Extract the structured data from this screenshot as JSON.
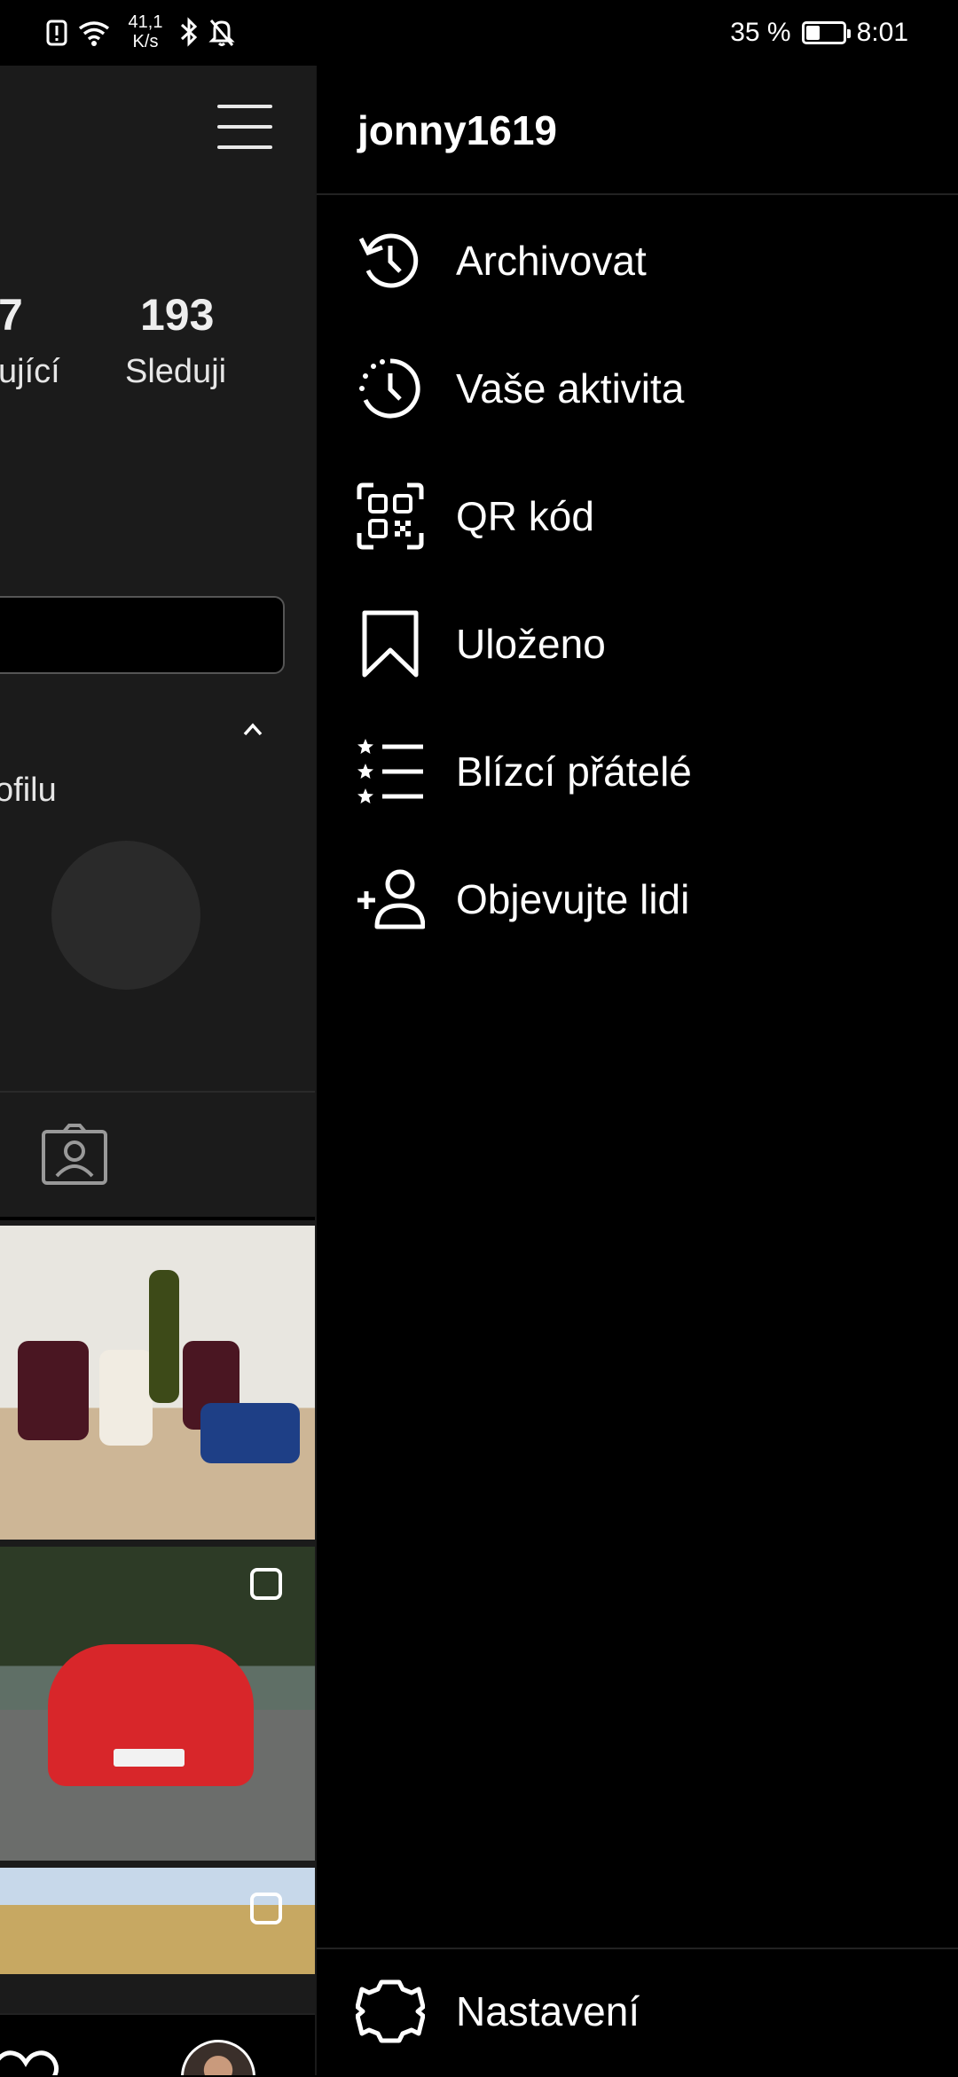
{
  "status_bar": {
    "net_speed_value": "41,1",
    "net_speed_unit": "K/s",
    "battery_percent": "35 %",
    "battery_level": 0.35,
    "time": "8:01"
  },
  "profile": {
    "stat_followers_num_partial": "7",
    "stat_followers_label_partial": "ující",
    "stat_following_num": "193",
    "stat_following_label": "Sleduji",
    "partial_text": "ofilu"
  },
  "drawer": {
    "username": "jonny1619",
    "menu": [
      {
        "label": "Archivovat",
        "icon": "archive-history-icon"
      },
      {
        "label": "Vaše aktivita",
        "icon": "activity-clock-icon"
      },
      {
        "label": "QR kód",
        "icon": "qr-code-icon"
      },
      {
        "label": "Uloženo",
        "icon": "bookmark-icon"
      },
      {
        "label": "Blízcí přátelé",
        "icon": "close-friends-list-icon"
      },
      {
        "label": "Objevujte lidi",
        "icon": "add-person-icon"
      }
    ],
    "settings_label": "Nastavení"
  }
}
